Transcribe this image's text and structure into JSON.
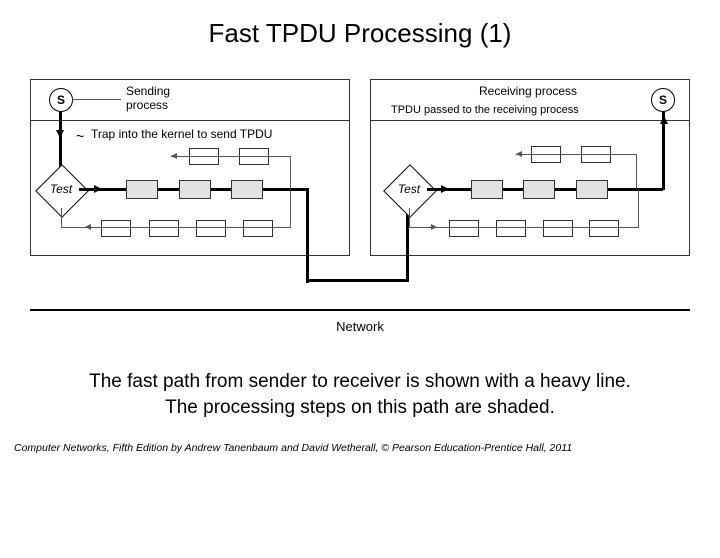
{
  "title": "Fast TPDU Processing (1)",
  "diagram": {
    "left": {
      "s_label": "S",
      "sending_process": "Sending\nprocess",
      "trap_label": "Trap into the kernel to send TPDU",
      "test_label": "Test"
    },
    "right": {
      "s_label": "S",
      "receiving_process": "Receiving process",
      "tpdu_passed": "TPDU passed to the receiving process",
      "test_label": "Test"
    },
    "network_label": "Network"
  },
  "caption_line1": "The fast path from sender to receiver is shown with a heavy line.",
  "caption_line2": "The processing steps on this path are shaded.",
  "footer": "Computer Networks, Fifth Edition by Andrew Tanenbaum and David Wetherall, © Pearson Education-Prentice Hall, 2011"
}
